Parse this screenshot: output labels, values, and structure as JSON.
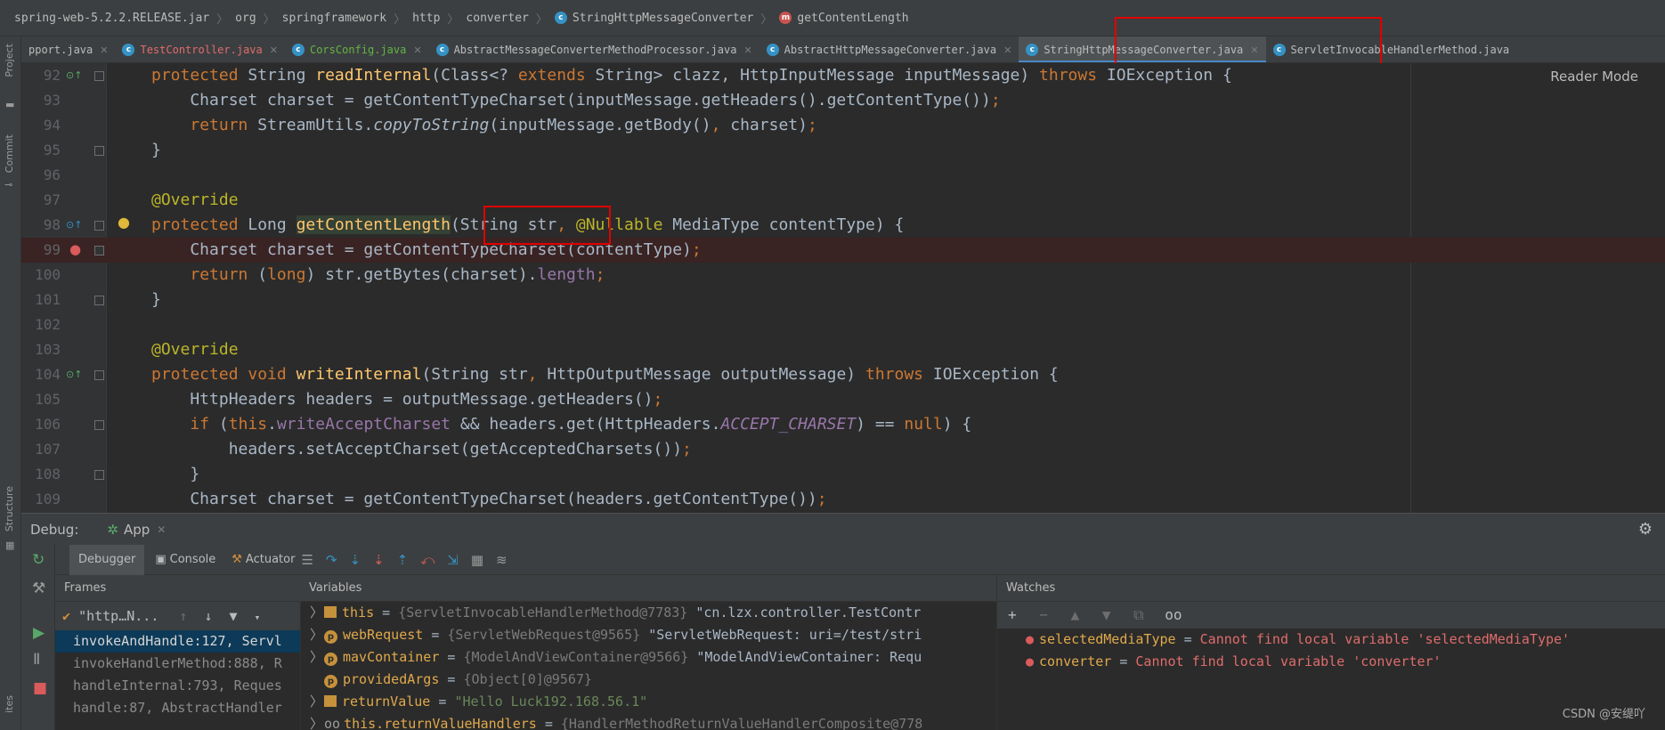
{
  "breadcrumb": [
    "spring-web-5.2.2.RELEASE.jar",
    "org",
    "springframework",
    "http",
    "converter",
    "StringHttpMessageConverter",
    "getContentLength"
  ],
  "left_strip": {
    "project": "Project",
    "commit": "Commit",
    "structure": "Structure",
    "favorites": "ites"
  },
  "tabs": [
    {
      "label": "pport.java",
      "color": "normal"
    },
    {
      "label": "TestController.java",
      "color": "red"
    },
    {
      "label": "CorsConfig.java",
      "color": "green"
    },
    {
      "label": "AbstractMessageConverterMethodProcessor.java",
      "color": "normal"
    },
    {
      "label": "AbstractHttpMessageConverter.java",
      "color": "normal"
    },
    {
      "label": "StringHttpMessageConverter.java",
      "color": "normal",
      "active": true
    },
    {
      "label": "ServletInvocableHandlerMethod.java",
      "color": "normal"
    }
  ],
  "editor": {
    "reader_mode": "Reader Mode",
    "line_numbers": [
      "92",
      "93",
      "94",
      "95",
      "96",
      "97",
      "98",
      "99",
      "100",
      "101",
      "102",
      "103",
      "104",
      "105",
      "106",
      "107",
      "108",
      "109"
    ]
  },
  "debug": {
    "title": "Debug:",
    "session": "App",
    "tabs": {
      "debugger": "Debugger",
      "console": "Console",
      "actuator": "Actuator"
    },
    "frames_title": "Frames",
    "thread": "\"http…N...",
    "frames": [
      "invokeAndHandle:127, Servl",
      "invokeHandlerMethod:888, R",
      "handleInternal:793, Reques",
      "handle:87, AbstractHandler"
    ],
    "variables_title": "Variables",
    "variables": [
      {
        "badge": "f",
        "name": "this",
        "type": "{ServletInvocableHandlerMethod@7783}",
        "value": "\"cn.lzx.controller.TestContr"
      },
      {
        "badge": "p",
        "name": "webRequest",
        "type": "{ServletWebRequest@9565}",
        "value": "\"ServletWebRequest: uri=/test/stri"
      },
      {
        "badge": "p",
        "name": "mavContainer",
        "type": "{ModelAndViewContainer@9566}",
        "value": "\"ModelAndViewContainer: Requ"
      },
      {
        "badge": "p",
        "name": "providedArgs",
        "type": "{Object[0]@9567}",
        "value": ""
      },
      {
        "badge": "f",
        "name": "returnValue",
        "type": "",
        "value": "\"Hello Luck192.168.56.1\""
      },
      {
        "badge": "oo",
        "name": "this.returnValueHandlers",
        "type": "{HandlerMethodReturnValueHandlerComposite@778",
        "value": ""
      }
    ],
    "watches_title": "Watches",
    "watches": [
      {
        "name": "selectedMediaType",
        "value": "Cannot find local variable 'selectedMediaType'"
      },
      {
        "name": "converter",
        "value": "Cannot find local variable 'converter'"
      }
    ]
  },
  "watermark": "CSDN @安缇吖"
}
